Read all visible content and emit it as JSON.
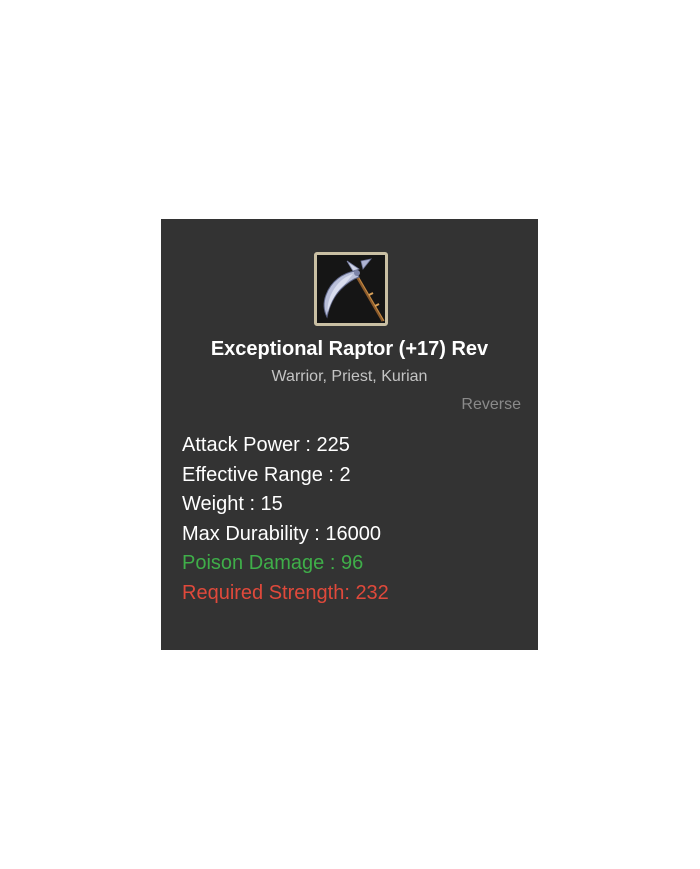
{
  "item": {
    "icon": "scythe-weapon-icon",
    "name": "Exceptional Raptor (+17) Rev",
    "classes": "Warrior, Priest, Kurian",
    "reverse_label": "Reverse"
  },
  "stats": {
    "attack_power": "Attack Power : 225",
    "effective_range": "Effective Range : 2",
    "weight": "Weight : 15",
    "max_durability": "Max Durability : 16000",
    "poison_damage": "Poison Damage : 96",
    "required_strength": "Required Strength: 232"
  },
  "colors": {
    "panel_background": "#333333",
    "poison_text": "#3fae49",
    "required_text": "#e0493b",
    "reverse_text": "#8a8a8a"
  }
}
